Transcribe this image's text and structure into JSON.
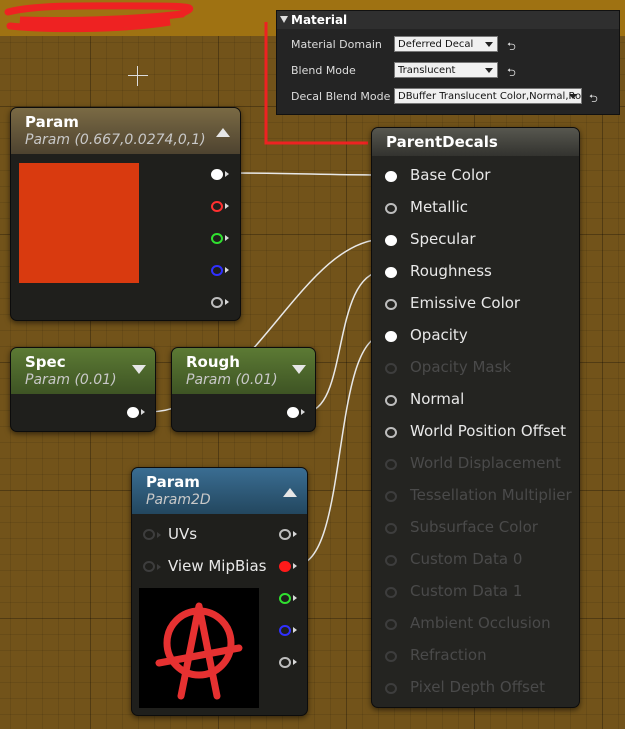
{
  "colors": {
    "canvas_bg": "#72531a",
    "top_strip": "#9f7212",
    "param_header": "#6b5a38",
    "scalar_header": "#4d6b2c",
    "texture_header": "#2d5875",
    "result_header": "#4a4a44",
    "red_swatch": "#d93a0f",
    "selection_red": "#ee2222"
  },
  "material_panel": {
    "title": "Material",
    "rows": [
      {
        "label": "Material Domain",
        "value": "Deferred Decal"
      },
      {
        "label": "Blend Mode",
        "value": "Translucent"
      },
      {
        "label": "Decal Blend Mode",
        "value": "DBuffer Translucent Color,Normal,Roughness"
      }
    ],
    "reset_icon": "reset-arrow-icon"
  },
  "nodes": {
    "param_color": {
      "title": "Param",
      "subtitle": "Param (0.667,0.0274,0,1)"
    },
    "spec": {
      "title": "Spec",
      "subtitle": "Param (0.01)"
    },
    "rough": {
      "title": "Rough",
      "subtitle": "Param (0.01)"
    },
    "param_texture": {
      "title": "Param",
      "subtitle": "Param2D",
      "inputs": [
        "UVs",
        "View MipBias"
      ],
      "preview_icon": "anarchy-symbol-icon"
    },
    "result": {
      "title": "ParentDecals",
      "inputs": [
        {
          "label": "Base Color",
          "state": "connected"
        },
        {
          "label": "Metallic",
          "state": "enabled"
        },
        {
          "label": "Specular",
          "state": "connected"
        },
        {
          "label": "Roughness",
          "state": "connected"
        },
        {
          "label": "Emissive Color",
          "state": "enabled"
        },
        {
          "label": "Opacity",
          "state": "connected"
        },
        {
          "label": "Opacity Mask",
          "state": "disabled"
        },
        {
          "label": "Normal",
          "state": "enabled"
        },
        {
          "label": "World Position Offset",
          "state": "enabled"
        },
        {
          "label": "World Displacement",
          "state": "disabled"
        },
        {
          "label": "Tessellation Multiplier",
          "state": "disabled"
        },
        {
          "label": "Subsurface Color",
          "state": "disabled"
        },
        {
          "label": "Custom Data 0",
          "state": "disabled"
        },
        {
          "label": "Custom Data 1",
          "state": "disabled"
        },
        {
          "label": "Ambient Occlusion",
          "state": "disabled"
        },
        {
          "label": "Refraction",
          "state": "disabled"
        },
        {
          "label": "Pixel Depth Offset",
          "state": "disabled"
        }
      ]
    }
  }
}
